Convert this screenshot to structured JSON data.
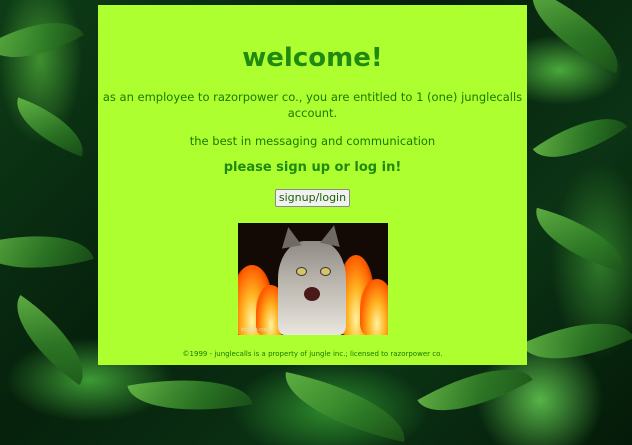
{
  "page": {
    "title": "welcome!",
    "intro": "as an employee to razorpower co., you are entitled to 1 (one) junglecalls account.",
    "tagline": "the best in messaging and communication",
    "cta": "please sign up or log in!",
    "button_label": "signup/login",
    "gif_watermark": "imgflip.com",
    "footer": "©1999 - junglecalls is a property of jungle inc.; licensed to razorpower co."
  },
  "colors": {
    "panel_bg": "#adff2f",
    "text_green": "#1a7a00",
    "title_green": "#208a10"
  },
  "icons": {
    "background": "jungle-leaves-background",
    "gif": "cat-on-fire-gif"
  }
}
